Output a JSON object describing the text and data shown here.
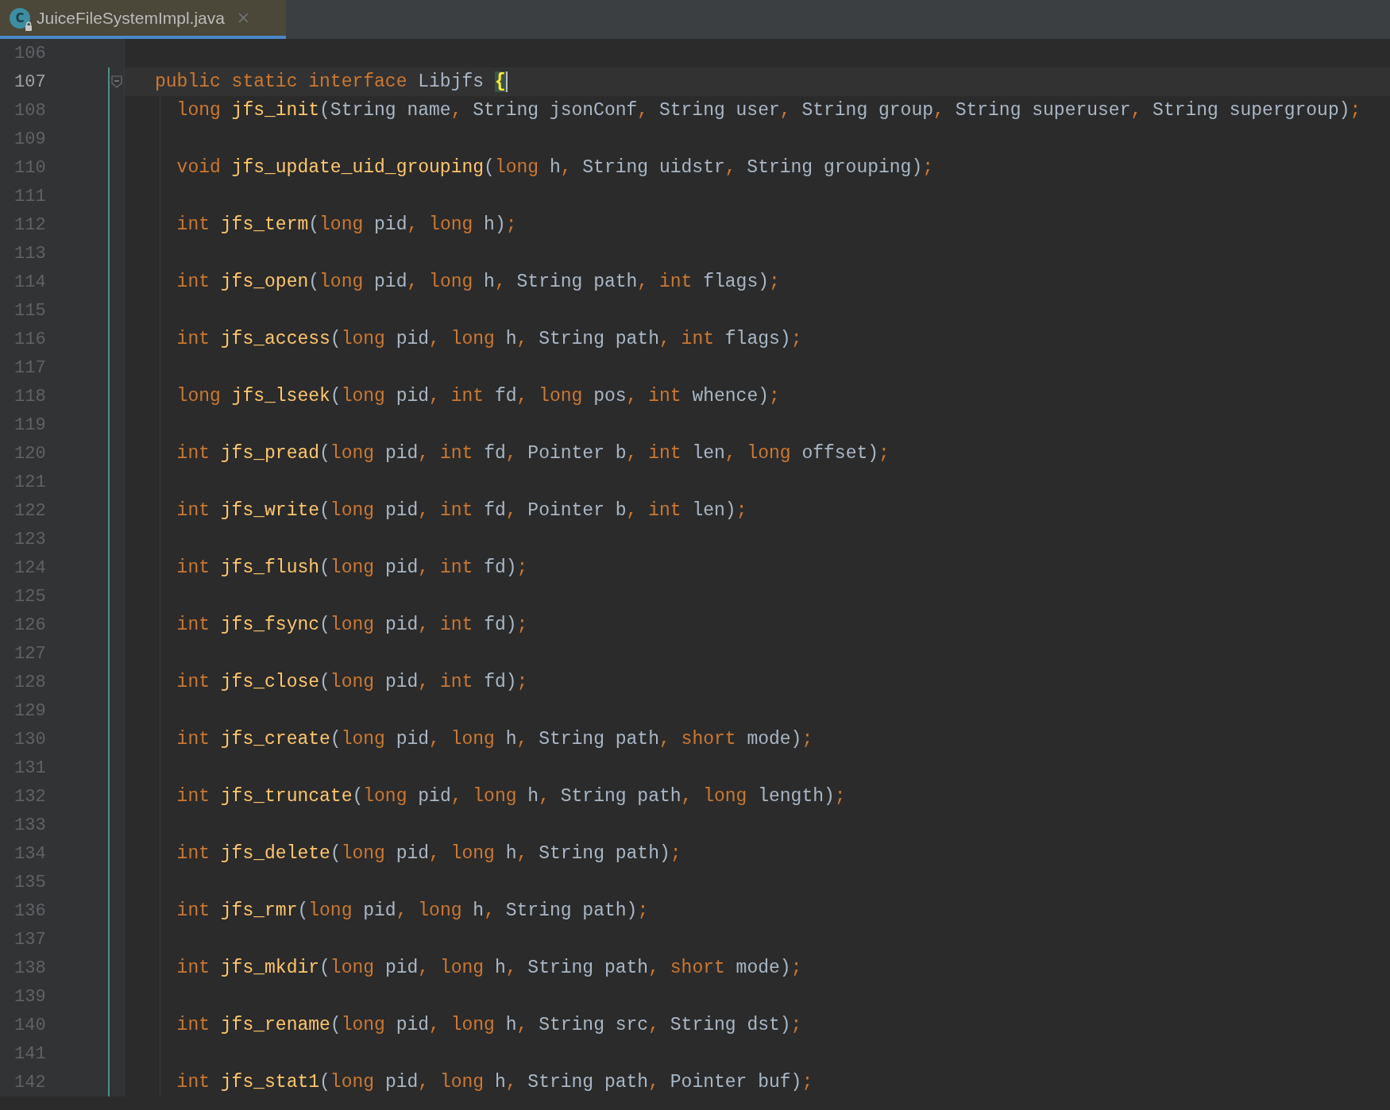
{
  "tab": {
    "icon_label": "C",
    "title": "JuiceFileSystemImpl.java",
    "selected": true,
    "locked": true
  },
  "lines": [
    {
      "number": "106"
    },
    {
      "number": "107",
      "current": true,
      "foldable": true,
      "vcs_changed": true,
      "tokens": [
        {
          "kind": "keyword",
          "text": "public static interface "
        },
        {
          "kind": "text",
          "text": "Libjfs "
        },
        {
          "kind": "brace",
          "text": "{"
        }
      ],
      "children": [
        {
          "number": "108",
          "tokens": [
            {
              "kind": "keyword",
              "text": "long "
            },
            {
              "kind": "function",
              "text": "jfs_init"
            },
            {
              "kind": "text",
              "text": "(String name"
            },
            {
              "kind": "punctuation",
              "text": ", "
            },
            {
              "kind": "text",
              "text": "String jsonConf"
            },
            {
              "kind": "punctuation",
              "text": ", "
            },
            {
              "kind": "text",
              "text": "String user"
            },
            {
              "kind": "punctuation",
              "text": ", "
            },
            {
              "kind": "text",
              "text": "String group"
            },
            {
              "kind": "punctuation",
              "text": ", "
            },
            {
              "kind": "text",
              "text": "String superuser"
            },
            {
              "kind": "punctuation",
              "text": ", "
            },
            {
              "kind": "text",
              "text": "String supergroup)"
            },
            {
              "kind": "punctuation",
              "text": ";"
            }
          ]
        },
        {
          "number": "109"
        },
        {
          "number": "110",
          "tokens": [
            {
              "kind": "keyword",
              "text": "void "
            },
            {
              "kind": "function",
              "text": "jfs_update_uid_grouping"
            },
            {
              "kind": "text",
              "text": "("
            },
            {
              "kind": "keyword",
              "text": "long "
            },
            {
              "kind": "text",
              "text": "h"
            },
            {
              "kind": "punctuation",
              "text": ", "
            },
            {
              "kind": "text",
              "text": "String uidstr"
            },
            {
              "kind": "punctuation",
              "text": ", "
            },
            {
              "kind": "text",
              "text": "String grouping)"
            },
            {
              "kind": "punctuation",
              "text": ";"
            }
          ]
        },
        {
          "number": "111"
        },
        {
          "number": "112",
          "tokens": [
            {
              "kind": "keyword",
              "text": "int "
            },
            {
              "kind": "function",
              "text": "jfs_term"
            },
            {
              "kind": "text",
              "text": "("
            },
            {
              "kind": "keyword",
              "text": "long "
            },
            {
              "kind": "text",
              "text": "pid"
            },
            {
              "kind": "punctuation",
              "text": ", "
            },
            {
              "kind": "keyword",
              "text": "long "
            },
            {
              "kind": "text",
              "text": "h)"
            },
            {
              "kind": "punctuation",
              "text": ";"
            }
          ]
        },
        {
          "number": "113"
        },
        {
          "number": "114",
          "tokens": [
            {
              "kind": "keyword",
              "text": "int "
            },
            {
              "kind": "function",
              "text": "jfs_open"
            },
            {
              "kind": "text",
              "text": "("
            },
            {
              "kind": "keyword",
              "text": "long "
            },
            {
              "kind": "text",
              "text": "pid"
            },
            {
              "kind": "punctuation",
              "text": ", "
            },
            {
              "kind": "keyword",
              "text": "long "
            },
            {
              "kind": "text",
              "text": "h"
            },
            {
              "kind": "punctuation",
              "text": ", "
            },
            {
              "kind": "text",
              "text": "String path"
            },
            {
              "kind": "punctuation",
              "text": ", "
            },
            {
              "kind": "keyword",
              "text": "int "
            },
            {
              "kind": "text",
              "text": "flags)"
            },
            {
              "kind": "punctuation",
              "text": ";"
            }
          ]
        },
        {
          "number": "115"
        },
        {
          "number": "116",
          "tokens": [
            {
              "kind": "keyword",
              "text": "int "
            },
            {
              "kind": "function",
              "text": "jfs_access"
            },
            {
              "kind": "text",
              "text": "("
            },
            {
              "kind": "keyword",
              "text": "long "
            },
            {
              "kind": "text",
              "text": "pid"
            },
            {
              "kind": "punctuation",
              "text": ", "
            },
            {
              "kind": "keyword",
              "text": "long "
            },
            {
              "kind": "text",
              "text": "h"
            },
            {
              "kind": "punctuation",
              "text": ", "
            },
            {
              "kind": "text",
              "text": "String path"
            },
            {
              "kind": "punctuation",
              "text": ", "
            },
            {
              "kind": "keyword",
              "text": "int "
            },
            {
              "kind": "text",
              "text": "flags)"
            },
            {
              "kind": "punctuation",
              "text": ";"
            }
          ]
        },
        {
          "number": "117"
        },
        {
          "number": "118",
          "tokens": [
            {
              "kind": "keyword",
              "text": "long "
            },
            {
              "kind": "function",
              "text": "jfs_lseek"
            },
            {
              "kind": "text",
              "text": "("
            },
            {
              "kind": "keyword",
              "text": "long "
            },
            {
              "kind": "text",
              "text": "pid"
            },
            {
              "kind": "punctuation",
              "text": ", "
            },
            {
              "kind": "keyword",
              "text": "int "
            },
            {
              "kind": "text",
              "text": "fd"
            },
            {
              "kind": "punctuation",
              "text": ", "
            },
            {
              "kind": "keyword",
              "text": "long "
            },
            {
              "kind": "text",
              "text": "pos"
            },
            {
              "kind": "punctuation",
              "text": ", "
            },
            {
              "kind": "keyword",
              "text": "int "
            },
            {
              "kind": "text",
              "text": "whence)"
            },
            {
              "kind": "punctuation",
              "text": ";"
            }
          ]
        },
        {
          "number": "119"
        },
        {
          "number": "120",
          "tokens": [
            {
              "kind": "keyword",
              "text": "int "
            },
            {
              "kind": "function",
              "text": "jfs_pread"
            },
            {
              "kind": "text",
              "text": "("
            },
            {
              "kind": "keyword",
              "text": "long "
            },
            {
              "kind": "text",
              "text": "pid"
            },
            {
              "kind": "punctuation",
              "text": ", "
            },
            {
              "kind": "keyword",
              "text": "int "
            },
            {
              "kind": "text",
              "text": "fd"
            },
            {
              "kind": "punctuation",
              "text": ", "
            },
            {
              "kind": "text",
              "text": "Pointer b"
            },
            {
              "kind": "punctuation",
              "text": ", "
            },
            {
              "kind": "keyword",
              "text": "int "
            },
            {
              "kind": "text",
              "text": "len"
            },
            {
              "kind": "punctuation",
              "text": ", "
            },
            {
              "kind": "keyword",
              "text": "long "
            },
            {
              "kind": "text",
              "text": "offset)"
            },
            {
              "kind": "punctuation",
              "text": ";"
            }
          ]
        },
        {
          "number": "121"
        },
        {
          "number": "122",
          "tokens": [
            {
              "kind": "keyword",
              "text": "int "
            },
            {
              "kind": "function",
              "text": "jfs_write"
            },
            {
              "kind": "text",
              "text": "("
            },
            {
              "kind": "keyword",
              "text": "long "
            },
            {
              "kind": "text",
              "text": "pid"
            },
            {
              "kind": "punctuation",
              "text": ", "
            },
            {
              "kind": "keyword",
              "text": "int "
            },
            {
              "kind": "text",
              "text": "fd"
            },
            {
              "kind": "punctuation",
              "text": ", "
            },
            {
              "kind": "text",
              "text": "Pointer b"
            },
            {
              "kind": "punctuation",
              "text": ", "
            },
            {
              "kind": "keyword",
              "text": "int "
            },
            {
              "kind": "text",
              "text": "len)"
            },
            {
              "kind": "punctuation",
              "text": ";"
            }
          ]
        },
        {
          "number": "123"
        },
        {
          "number": "124",
          "tokens": [
            {
              "kind": "keyword",
              "text": "int "
            },
            {
              "kind": "function",
              "text": "jfs_flush"
            },
            {
              "kind": "text",
              "text": "("
            },
            {
              "kind": "keyword",
              "text": "long "
            },
            {
              "kind": "text",
              "text": "pid"
            },
            {
              "kind": "punctuation",
              "text": ", "
            },
            {
              "kind": "keyword",
              "text": "int "
            },
            {
              "kind": "text",
              "text": "fd)"
            },
            {
              "kind": "punctuation",
              "text": ";"
            }
          ]
        },
        {
          "number": "125"
        },
        {
          "number": "126",
          "tokens": [
            {
              "kind": "keyword",
              "text": "int "
            },
            {
              "kind": "function",
              "text": "jfs_fsync"
            },
            {
              "kind": "text",
              "text": "("
            },
            {
              "kind": "keyword",
              "text": "long "
            },
            {
              "kind": "text",
              "text": "pid"
            },
            {
              "kind": "punctuation",
              "text": ", "
            },
            {
              "kind": "keyword",
              "text": "int "
            },
            {
              "kind": "text",
              "text": "fd)"
            },
            {
              "kind": "punctuation",
              "text": ";"
            }
          ]
        },
        {
          "number": "127"
        },
        {
          "number": "128",
          "tokens": [
            {
              "kind": "keyword",
              "text": "int "
            },
            {
              "kind": "function",
              "text": "jfs_close"
            },
            {
              "kind": "text",
              "text": "("
            },
            {
              "kind": "keyword",
              "text": "long "
            },
            {
              "kind": "text",
              "text": "pid"
            },
            {
              "kind": "punctuation",
              "text": ", "
            },
            {
              "kind": "keyword",
              "text": "int "
            },
            {
              "kind": "text",
              "text": "fd)"
            },
            {
              "kind": "punctuation",
              "text": ";"
            }
          ]
        },
        {
          "number": "129"
        },
        {
          "number": "130",
          "tokens": [
            {
              "kind": "keyword",
              "text": "int "
            },
            {
              "kind": "function",
              "text": "jfs_create"
            },
            {
              "kind": "text",
              "text": "("
            },
            {
              "kind": "keyword",
              "text": "long "
            },
            {
              "kind": "text",
              "text": "pid"
            },
            {
              "kind": "punctuation",
              "text": ", "
            },
            {
              "kind": "keyword",
              "text": "long "
            },
            {
              "kind": "text",
              "text": "h"
            },
            {
              "kind": "punctuation",
              "text": ", "
            },
            {
              "kind": "text",
              "text": "String path"
            },
            {
              "kind": "punctuation",
              "text": ", "
            },
            {
              "kind": "keyword",
              "text": "short "
            },
            {
              "kind": "text",
              "text": "mode)"
            },
            {
              "kind": "punctuation",
              "text": ";"
            }
          ]
        },
        {
          "number": "131"
        },
        {
          "number": "132",
          "tokens": [
            {
              "kind": "keyword",
              "text": "int "
            },
            {
              "kind": "function",
              "text": "jfs_truncate"
            },
            {
              "kind": "text",
              "text": "("
            },
            {
              "kind": "keyword",
              "text": "long "
            },
            {
              "kind": "text",
              "text": "pid"
            },
            {
              "kind": "punctuation",
              "text": ", "
            },
            {
              "kind": "keyword",
              "text": "long "
            },
            {
              "kind": "text",
              "text": "h"
            },
            {
              "kind": "punctuation",
              "text": ", "
            },
            {
              "kind": "text",
              "text": "String path"
            },
            {
              "kind": "punctuation",
              "text": ", "
            },
            {
              "kind": "keyword",
              "text": "long "
            },
            {
              "kind": "text",
              "text": "length)"
            },
            {
              "kind": "punctuation",
              "text": ";"
            }
          ]
        },
        {
          "number": "133"
        },
        {
          "number": "134",
          "tokens": [
            {
              "kind": "keyword",
              "text": "int "
            },
            {
              "kind": "function",
              "text": "jfs_delete"
            },
            {
              "kind": "text",
              "text": "("
            },
            {
              "kind": "keyword",
              "text": "long "
            },
            {
              "kind": "text",
              "text": "pid"
            },
            {
              "kind": "punctuation",
              "text": ", "
            },
            {
              "kind": "keyword",
              "text": "long "
            },
            {
              "kind": "text",
              "text": "h"
            },
            {
              "kind": "punctuation",
              "text": ", "
            },
            {
              "kind": "text",
              "text": "String path)"
            },
            {
              "kind": "punctuation",
              "text": ";"
            }
          ]
        },
        {
          "number": "135"
        },
        {
          "number": "136",
          "tokens": [
            {
              "kind": "keyword",
              "text": "int "
            },
            {
              "kind": "function",
              "text": "jfs_rmr"
            },
            {
              "kind": "text",
              "text": "("
            },
            {
              "kind": "keyword",
              "text": "long "
            },
            {
              "kind": "text",
              "text": "pid"
            },
            {
              "kind": "punctuation",
              "text": ", "
            },
            {
              "kind": "keyword",
              "text": "long "
            },
            {
              "kind": "text",
              "text": "h"
            },
            {
              "kind": "punctuation",
              "text": ", "
            },
            {
              "kind": "text",
              "text": "String path)"
            },
            {
              "kind": "punctuation",
              "text": ";"
            }
          ]
        },
        {
          "number": "137"
        },
        {
          "number": "138",
          "tokens": [
            {
              "kind": "keyword",
              "text": "int "
            },
            {
              "kind": "function",
              "text": "jfs_mkdir"
            },
            {
              "kind": "text",
              "text": "("
            },
            {
              "kind": "keyword",
              "text": "long "
            },
            {
              "kind": "text",
              "text": "pid"
            },
            {
              "kind": "punctuation",
              "text": ", "
            },
            {
              "kind": "keyword",
              "text": "long "
            },
            {
              "kind": "text",
              "text": "h"
            },
            {
              "kind": "punctuation",
              "text": ", "
            },
            {
              "kind": "text",
              "text": "String path"
            },
            {
              "kind": "punctuation",
              "text": ", "
            },
            {
              "kind": "keyword",
              "text": "short "
            },
            {
              "kind": "text",
              "text": "mode)"
            },
            {
              "kind": "punctuation",
              "text": ";"
            }
          ]
        },
        {
          "number": "139"
        },
        {
          "number": "140",
          "tokens": [
            {
              "kind": "keyword",
              "text": "int "
            },
            {
              "kind": "function",
              "text": "jfs_rename"
            },
            {
              "kind": "text",
              "text": "("
            },
            {
              "kind": "keyword",
              "text": "long "
            },
            {
              "kind": "text",
              "text": "pid"
            },
            {
              "kind": "punctuation",
              "text": ", "
            },
            {
              "kind": "keyword",
              "text": "long "
            },
            {
              "kind": "text",
              "text": "h"
            },
            {
              "kind": "punctuation",
              "text": ", "
            },
            {
              "kind": "text",
              "text": "String src"
            },
            {
              "kind": "punctuation",
              "text": ", "
            },
            {
              "kind": "text",
              "text": "String dst)"
            },
            {
              "kind": "punctuation",
              "text": ";"
            }
          ]
        },
        {
          "number": "141"
        },
        {
          "number": "142",
          "tokens": [
            {
              "kind": "keyword",
              "text": "int "
            },
            {
              "kind": "function",
              "text": "jfs_stat1"
            },
            {
              "kind": "text",
              "text": "("
            },
            {
              "kind": "keyword",
              "text": "long "
            },
            {
              "kind": "text",
              "text": "pid"
            },
            {
              "kind": "punctuation",
              "text": ", "
            },
            {
              "kind": "keyword",
              "text": "long "
            },
            {
              "kind": "text",
              "text": "h"
            },
            {
              "kind": "punctuation",
              "text": ", "
            },
            {
              "kind": "text",
              "text": "String path"
            },
            {
              "kind": "punctuation",
              "text": ", "
            },
            {
              "kind": "text",
              "text": "Pointer buf)"
            },
            {
              "kind": "punctuation",
              "text": ";"
            }
          ]
        }
      ]
    }
  ]
}
